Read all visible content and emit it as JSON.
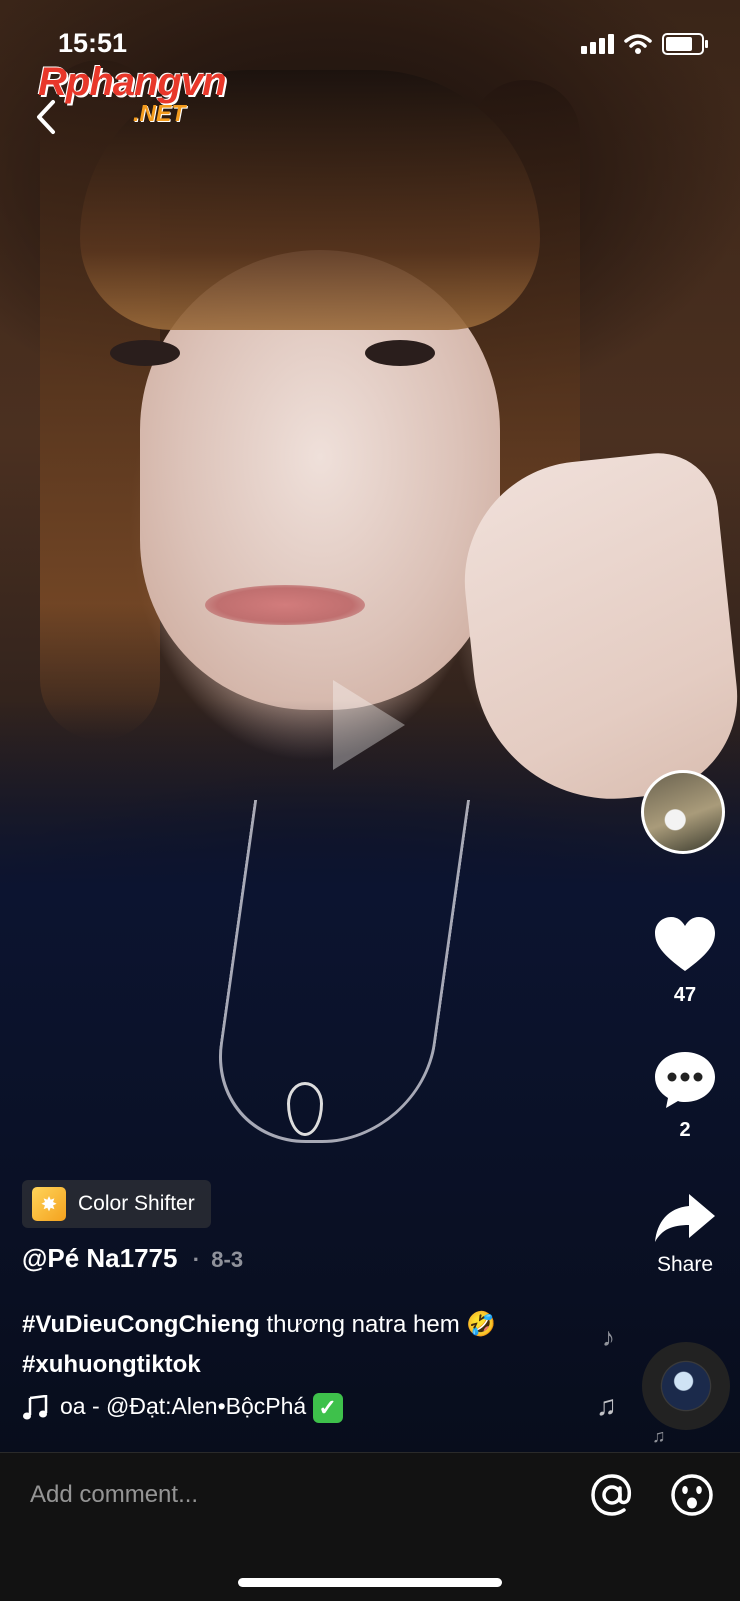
{
  "status_bar": {
    "time": "15:51",
    "battery_level": 0.85
  },
  "watermark": {
    "main": "Rphangvn",
    "suffix": ".NET"
  },
  "player": {
    "state": "paused"
  },
  "actions": {
    "likes": "47",
    "comments": "2",
    "share_label": "Share"
  },
  "effect": {
    "label": "Color Shifter"
  },
  "post": {
    "author": "@Pé Na1775",
    "date_separator": "·",
    "date": "8-3",
    "hashtag_1": "#VuDieuCongChieng",
    "caption_text": " thương natra hem 🤣",
    "hashtag_2": "#xuhuongtiktok",
    "music": "oa - @Đạt:Alen•BộcPhá",
    "music_verified_mark": "✓"
  },
  "comment_bar": {
    "placeholder": "Add comment..."
  },
  "icons": {
    "back": "chevron-left-icon",
    "like": "heart-icon",
    "comment": "speech-bubble-icon",
    "share": "share-arrow-icon",
    "mention": "at-sign-icon",
    "emoji": "smiley-icon",
    "music": "music-note-icon"
  }
}
